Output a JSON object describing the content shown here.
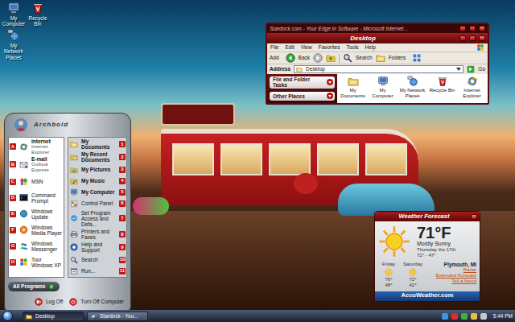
{
  "desktop_icons": [
    {
      "label": "My Computer"
    },
    {
      "label": "Recycle Bin"
    },
    {
      "label": "My Network Places"
    }
  ],
  "explorer": {
    "caption": "Stardock.com - Your Edge In Software - Microsoft Internet...",
    "title": "Desktop",
    "menu": [
      "File",
      "Edit",
      "View",
      "Favorites",
      "Tools",
      "Help"
    ],
    "toolbar_stub": "Add",
    "toolbar": [
      "Back",
      "Search",
      "Folders"
    ],
    "address_label": "Address",
    "address": "Desktop",
    "go": "Go",
    "panels": [
      {
        "title": "File and Folder Tasks",
        "expanded": false
      },
      {
        "title": "Other Places",
        "expanded": false
      }
    ],
    "items": [
      "My Documents",
      "My Computer",
      "My Network Places",
      "Recycle Bin",
      "Internet Explorer"
    ]
  },
  "start_menu": {
    "user": "Archbold",
    "pinned": [
      {
        "key": "A",
        "title": "Internet",
        "subtitle": "Internet Explorer"
      },
      {
        "key": "B",
        "title": "E-mail",
        "subtitle": "Outlook Express"
      },
      {
        "key": "C",
        "title": "MSN"
      },
      {
        "key": "D",
        "title": "Command Prompt"
      },
      {
        "key": "E",
        "title": "Windows Update"
      },
      {
        "key": "F",
        "title": "Windows Media Player"
      },
      {
        "key": "G",
        "title": "Windows Messenger"
      },
      {
        "key": "H",
        "title": "Tour Windows XP"
      }
    ],
    "places": [
      {
        "key": "1",
        "label": "My Documents",
        "kind": "place"
      },
      {
        "key": "2",
        "label": "My Recent Documents",
        "kind": "place"
      },
      {
        "key": "3",
        "label": "My Pictures",
        "kind": "place"
      },
      {
        "key": "4",
        "label": "My Music",
        "kind": "place"
      },
      {
        "key": "5",
        "label": "My Computer",
        "kind": "place"
      },
      {
        "key": "6",
        "label": "Control Panel",
        "kind": "tool"
      },
      {
        "key": "7",
        "label": "Set Program Access and Defa...",
        "kind": "tool"
      },
      {
        "key": "8",
        "label": "Printers and Faxes",
        "kind": "tool"
      },
      {
        "key": "9",
        "label": "Help and Support",
        "kind": "tool"
      },
      {
        "key": "10",
        "label": "Search",
        "kind": "tool"
      },
      {
        "key": "11",
        "label": "Run...",
        "kind": "tool"
      }
    ],
    "all_programs": "All Programs",
    "footer": [
      "Log Off",
      "Turn Off Computer"
    ]
  },
  "weather": {
    "title": "Weather Forecast",
    "temp": "71°F",
    "condition": "Mostly Sunny",
    "date": "Thursday the 17th",
    "range": "72° - 47°",
    "days": [
      {
        "day": "Friday",
        "high": "76°",
        "low": "48°"
      },
      {
        "day": "Saturday",
        "high": "72°",
        "low": "42°"
      }
    ],
    "location": "Plymouth, MI",
    "links": [
      "Radar",
      "Extended Forecast",
      "Tell a friend"
    ],
    "brand": "AccuWeather.com"
  },
  "taskbar": {
    "tasks": [
      {
        "label": "Desktop",
        "selected": true
      },
      {
        "label": "Stardock - You...",
        "selected": false
      }
    ],
    "clock": "5:44 PM"
  }
}
